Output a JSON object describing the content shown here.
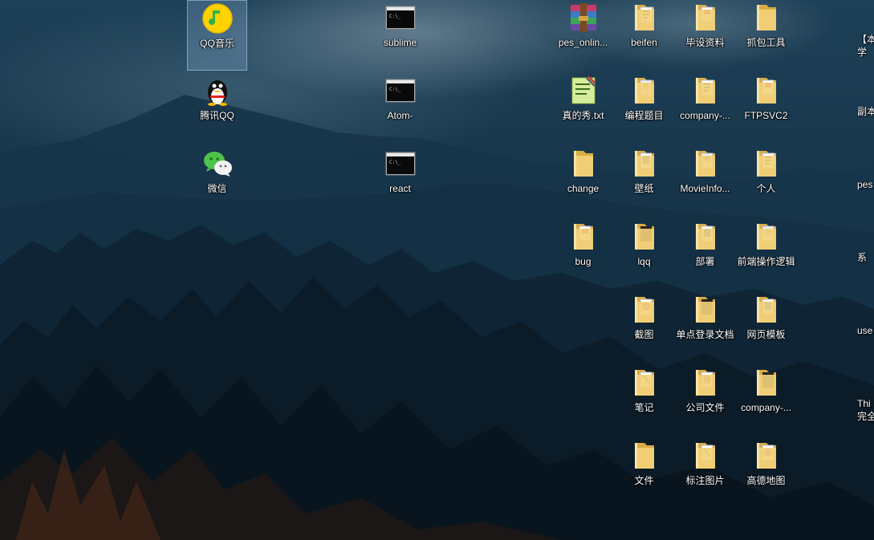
{
  "desktop": {
    "icons": [
      {
        "label": "QQ音乐",
        "icon": "qq-music-icon",
        "selected": true
      },
      {
        "label": "腾讯QQ",
        "icon": "qq-penguin-icon"
      },
      {
        "label": "微信",
        "icon": "wechat-icon"
      },
      {
        "label": "sublime",
        "icon": "console-shortcut-icon"
      },
      {
        "label": "Atom-",
        "icon": "console-shortcut-icon"
      },
      {
        "label": "react",
        "icon": "console-shortcut-icon"
      },
      {
        "label": "pes_onlin...",
        "icon": "winrar-archive-icon"
      },
      {
        "label": "真的秀.txt",
        "icon": "text-file-icon"
      },
      {
        "label": "change",
        "icon": "folder-icon"
      },
      {
        "label": "bug",
        "icon": "folder-icon"
      },
      {
        "label": "beifen",
        "icon": "folder-icon"
      },
      {
        "label": "编程题目",
        "icon": "folder-icon"
      },
      {
        "label": "壁纸",
        "icon": "folder-icon"
      },
      {
        "label": "lqq",
        "icon": "folder-icon"
      },
      {
        "label": "截图",
        "icon": "folder-icon"
      },
      {
        "label": "笔记",
        "icon": "folder-icon"
      },
      {
        "label": "文件",
        "icon": "folder-icon"
      },
      {
        "label": "毕设资料",
        "icon": "folder-icon"
      },
      {
        "label": "company-...",
        "icon": "folder-icon"
      },
      {
        "label": "MovieInfo...",
        "icon": "folder-icon"
      },
      {
        "label": "部署",
        "icon": "folder-icon"
      },
      {
        "label": "单点登录文档",
        "icon": "folder-icon"
      },
      {
        "label": "公司文件",
        "icon": "folder-icon"
      },
      {
        "label": "标注图片",
        "icon": "folder-icon"
      },
      {
        "label": "抓包工具",
        "icon": "folder-icon"
      },
      {
        "label": "FTPSVC2",
        "icon": "folder-icon"
      },
      {
        "label": "个人",
        "icon": "folder-icon"
      },
      {
        "label": "前端操作逻辑",
        "icon": "folder-icon"
      },
      {
        "label": "网页模板",
        "icon": "folder-icon"
      },
      {
        "label": "company-...",
        "icon": "folder-icon"
      },
      {
        "label": "高德地图",
        "icon": "folder-icon"
      },
      {
        "label": "【本",
        "icon": "partial-icon"
      },
      {
        "label": "学",
        "icon": "partial-icon"
      },
      {
        "label": "副本",
        "icon": "partial-icon"
      },
      {
        "label": "pes",
        "icon": "partial-icon"
      },
      {
        "label": "系",
        "icon": "partial-icon"
      },
      {
        "label": "use",
        "icon": "partial-icon"
      },
      {
        "label": "Thi",
        "icon": "partial-icon"
      },
      {
        "label": "完全",
        "icon": "partial-icon"
      }
    ]
  },
  "colors": {
    "folder": "#f3d27a",
    "folder_dark": "#d9ac45",
    "selection": "#add6ff",
    "label": "#ffffff"
  }
}
